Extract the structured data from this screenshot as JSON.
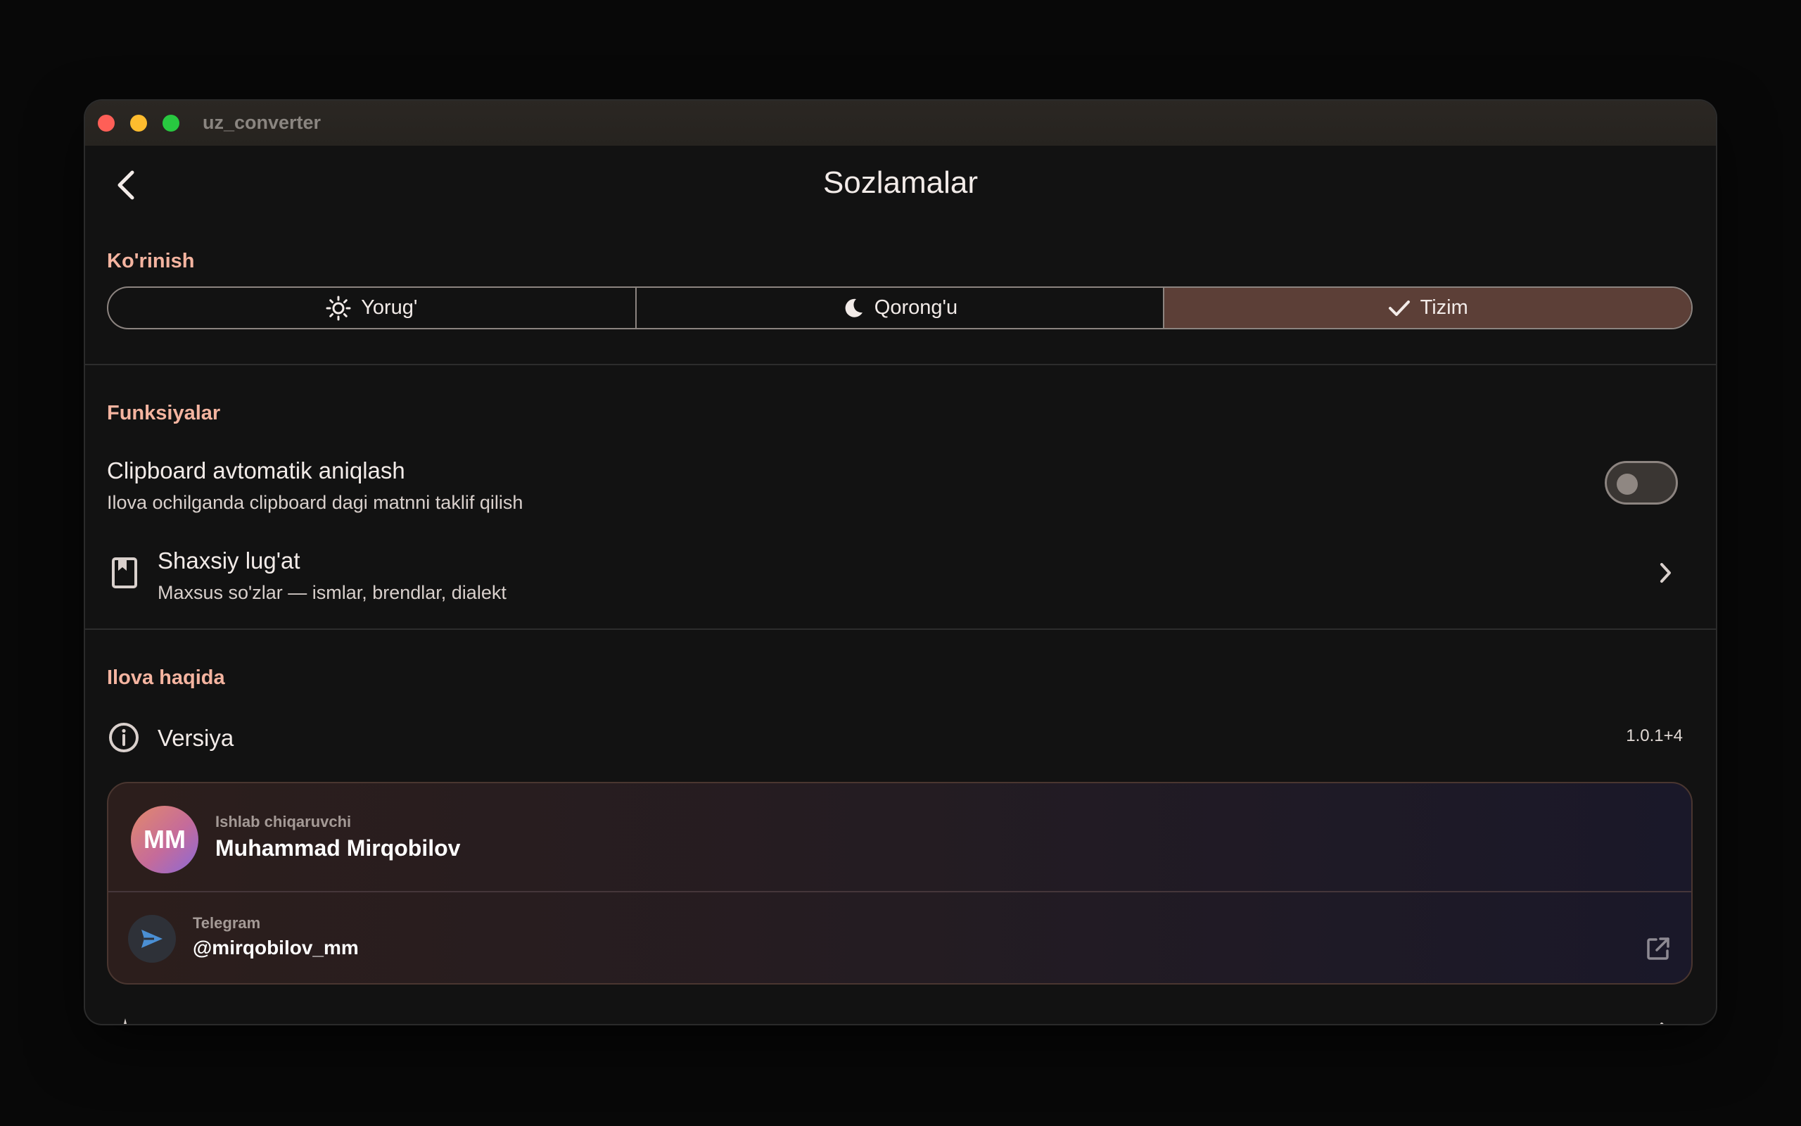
{
  "window": {
    "title": "uz_converter"
  },
  "appbar": {
    "title": "Sozlamalar"
  },
  "appearance": {
    "label": "Ko'rinish",
    "options": [
      {
        "label": "Yorug'",
        "icon": "sun-icon"
      },
      {
        "label": "Qorong'u",
        "icon": "moon-icon"
      },
      {
        "label": "Tizim",
        "icon": "check-icon"
      }
    ],
    "selected": "Tizim"
  },
  "features": {
    "label": "Funksiyalar",
    "clipboard": {
      "title": "Clipboard avtomatik aniqlash",
      "subtitle": "Ilova ochilganda clipboard dagi matnni taklif qilish",
      "enabled": false
    },
    "dictionary": {
      "title": "Shaxsiy lug'at",
      "subtitle": "Maxsus so'zlar — ismlar, brendlar, dialekt",
      "icon": "bookmark-book-icon"
    }
  },
  "about": {
    "label": "Ilova haqida",
    "version_label": "Versiya",
    "version_value": "1.0.1+4",
    "developer": {
      "kicker": "Ishlab chiqaruvchi",
      "name": "Muhammad Mirqobilov",
      "initials": "MM"
    },
    "telegram": {
      "kicker": "Telegram",
      "handle": "@mirqobilov_mm"
    }
  },
  "colors": {
    "accent": "#f4b4a0",
    "selected_segment": "#5c3f37",
    "background": "#121212"
  }
}
